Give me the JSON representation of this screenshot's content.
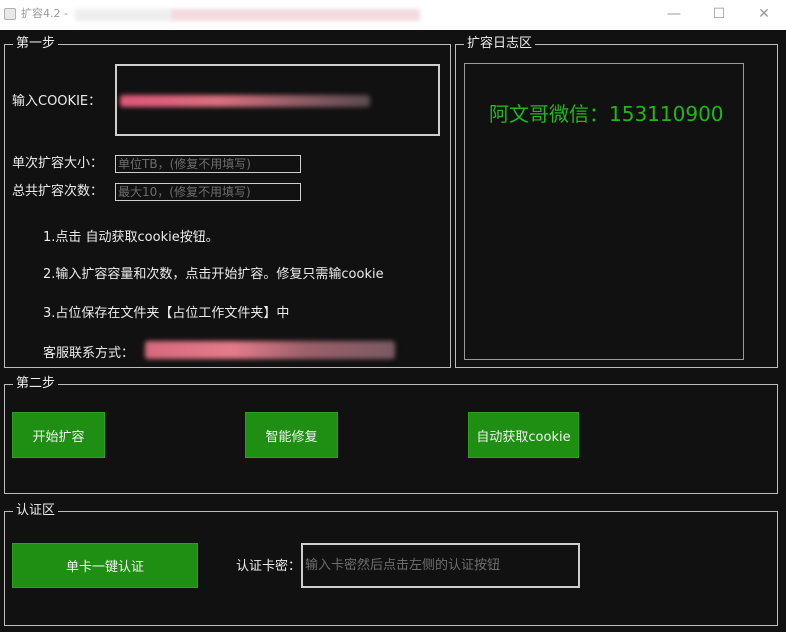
{
  "window": {
    "title": "扩容4.2 -",
    "minimize": "—",
    "maximize": "☐",
    "close": "✕"
  },
  "step1": {
    "title": "第一步",
    "cookie_label": "输入COOKIE：",
    "single_size_label": "单次扩容大小：",
    "single_size_placeholder": "单位TB，(修复不用填写)",
    "total_count_label": "总共扩容次数：",
    "total_count_placeholder": "最大10，(修复不用填写)",
    "instructions": [
      "1.点击 自动获取cookie按钮。",
      "2.输入扩容容量和次数，点击开始扩容。修复只需输cookie",
      "3.占位保存在文件夹【占位工作文件夹】中"
    ],
    "contact_label": "客服联系方式："
  },
  "log": {
    "title": "扩容日志区",
    "wechat_text": "阿文哥微信：153110900",
    "wechat_color": "#22b61a"
  },
  "step2": {
    "title": "第二步",
    "start_button": "开始扩容",
    "repair_button": "智能修复",
    "auto_cookie_button": "自动获取cookie"
  },
  "auth": {
    "title": "认证区",
    "auth_button": "单卡一键认证",
    "key_label": "认证卡密：",
    "key_placeholder": "输入卡密然后点击左侧的认证按钮"
  },
  "colors": {
    "accent_button": "#1f8f14",
    "background": "#111111"
  }
}
